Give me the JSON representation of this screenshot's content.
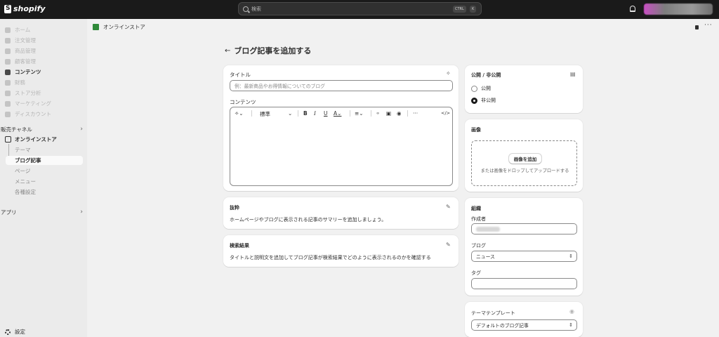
{
  "topbar": {
    "logo": "shopify",
    "search_placeholder": "検索",
    "kbd_ctrl": "CTRL",
    "kbd_k": "K"
  },
  "sidebar": {
    "items": [
      {
        "label": "ホーム",
        "icon": "home-icon",
        "strong": false
      },
      {
        "label": "注文管理",
        "icon": "inbox-icon",
        "strong": false
      },
      {
        "label": "商品管理",
        "icon": "tag-icon",
        "strong": false
      },
      {
        "label": "顧客管理",
        "icon": "person-icon",
        "strong": false
      },
      {
        "label": "コンテンツ",
        "icon": "content-icon",
        "strong": true
      },
      {
        "label": "財務",
        "icon": "bank-icon",
        "strong": false
      },
      {
        "label": "ストア分析",
        "icon": "chart-icon",
        "strong": false
      },
      {
        "label": "マーケティング",
        "icon": "target-icon",
        "strong": false
      },
      {
        "label": "ディスカウント",
        "icon": "discount-icon",
        "strong": false
      }
    ],
    "sales_channels": "販売チャネル",
    "online_store": "オンラインストア",
    "sub_items": [
      "テーマ",
      "ブログ記事",
      "ページ",
      "メニュー",
      "各種設定"
    ],
    "active_sub": "ブログ記事",
    "apps": "アプリ",
    "settings": "設定"
  },
  "breadcrumb": "オンラインストア",
  "page_title": "ブログ記事を追加する",
  "title_card": {
    "title_label": "タイトル",
    "title_placeholder": "例：最新商品やお得情報についてのブログ",
    "content_label": "コンテンツ",
    "format_select": "標準"
  },
  "excerpt_card": {
    "heading": "抜粋",
    "text": "ホームページやブログに表示される記事のサマリーを追加しましょう。"
  },
  "seo_card": {
    "heading": "検索結果",
    "text": "タイトルと説明文を追加してブログ記事が検索結果でどのように表示されるのかを確認する"
  },
  "visibility_card": {
    "heading": "公開 / 非公開",
    "options": [
      "公開",
      "非公開"
    ],
    "selected": "非公開"
  },
  "image_card": {
    "heading": "画像",
    "button": "画像を追加",
    "hint": "または画像をドロップしてアップロードする"
  },
  "organization_card": {
    "heading": "組織",
    "author_label": "作成者",
    "blog_label": "ブログ",
    "blog_value": "ニュース",
    "tags_label": "タグ"
  },
  "template_card": {
    "heading": "テーマテンプレート",
    "value": "デフォルトのブログ記事"
  },
  "colors": {
    "topbar": "#1a1a1a",
    "page_bg": "#f1f1f1",
    "sidebar_bg": "#ebebeb",
    "card_bg": "#ffffff"
  }
}
